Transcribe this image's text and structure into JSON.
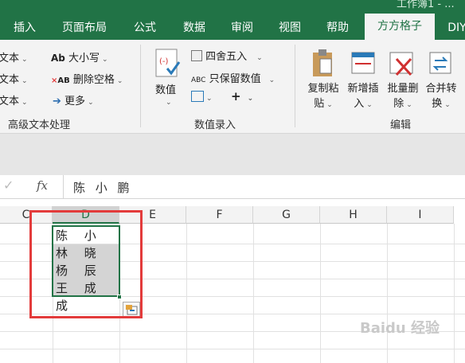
{
  "title_fragment": "工作簿1 - ...",
  "tabs": [
    {
      "label": "插入"
    },
    {
      "label": "页面布局"
    },
    {
      "label": "公式"
    },
    {
      "label": "数据"
    },
    {
      "label": "审阅"
    },
    {
      "label": "视图"
    },
    {
      "label": "帮助"
    },
    {
      "label": "方方格子"
    },
    {
      "label": "DIY"
    }
  ],
  "ribbon": {
    "text_group": {
      "left_items": [
        "文本",
        "文本",
        "文本"
      ],
      "case_label": "大小写",
      "case_icon_text": "Ab",
      "remove_space_label": "删除空格",
      "remove_space_icon_text": "AB",
      "more_label": "更多",
      "group_label": "高级文本处理"
    },
    "number_group": {
      "value_label": "数值",
      "round_label": "四舍五入",
      "keep_value_label": "只保留数值",
      "keep_value_icon_text": "ABC",
      "plus_label": "+",
      "group_label": "数值录入"
    },
    "edit_group": {
      "copy_paste_label": [
        "复制粘",
        "贴"
      ],
      "insert_label": [
        "新增插",
        "入"
      ],
      "batch_delete_label": [
        "批量删",
        "除"
      ],
      "merge_label": [
        "合并转",
        "换"
      ],
      "group_label": "编辑"
    }
  },
  "formula_bar": {
    "fx_label": "fx",
    "content": "陈 小 鹏"
  },
  "sheet": {
    "columns": [
      "C",
      "D",
      "E",
      "F",
      "G",
      "H",
      "I"
    ],
    "selected_column": "D",
    "cells_d": [
      {
        "value": "陈 小 鹏",
        "shaded": false
      },
      {
        "value": "林 晓 玲",
        "shaded": true
      },
      {
        "value": "杨 辰",
        "shaded": true
      },
      {
        "value": "王 成 成",
        "shaded": true
      }
    ]
  },
  "watermark": "Baidu 经验",
  "colors": {
    "excel_green": "#217346",
    "highlight_red": "#e33b3b",
    "selection_gray": "#d4d4d4"
  }
}
